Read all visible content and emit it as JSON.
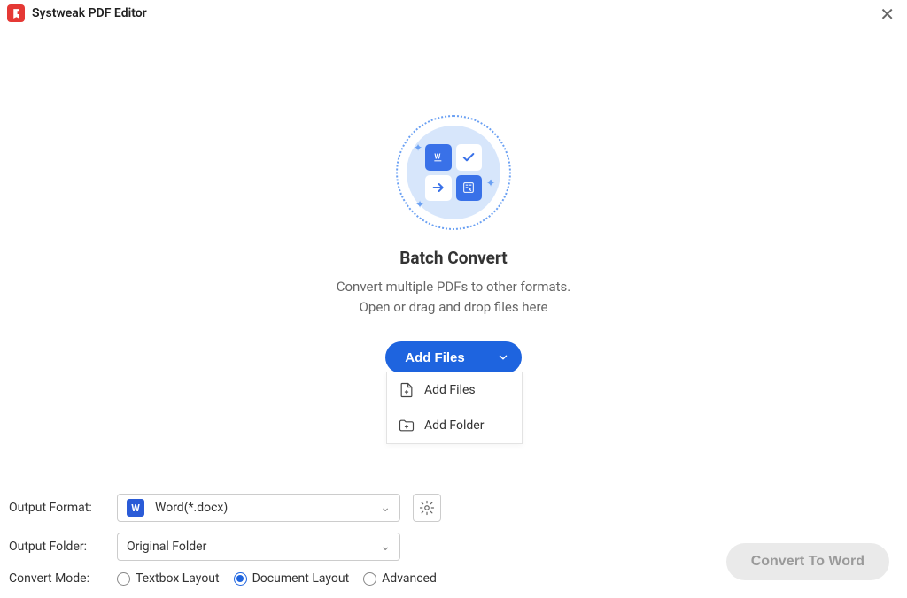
{
  "app": {
    "title": "Systweak PDF Editor",
    "close_glyph": "✕"
  },
  "hero": {
    "heading": "Batch Convert",
    "line1": "Convert multiple PDFs to other formats.",
    "line2": "Open or drag and drop files here"
  },
  "add_files": {
    "button_label": "Add Files",
    "menu": {
      "item1": "Add Files",
      "item2": "Add Folder"
    }
  },
  "settings": {
    "output_format": {
      "label": "Output Format:",
      "value": "Word(*.docx)",
      "icon_letter": "W"
    },
    "output_folder": {
      "label": "Output Folder:",
      "value": "Original Folder"
    },
    "convert_mode": {
      "label": "Convert Mode:",
      "options": {
        "textbox": "Textbox Layout",
        "document": "Document Layout",
        "advanced": "Advanced"
      },
      "selected": "document"
    }
  },
  "action": {
    "convert_label": "Convert To Word"
  }
}
